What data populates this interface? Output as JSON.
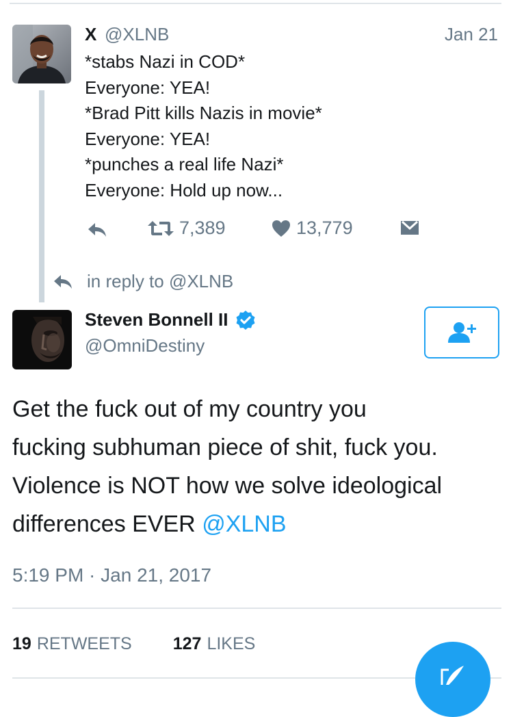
{
  "parent_tweet": {
    "author_name": "X",
    "author_handle": "@XLNB",
    "date": "Jan 21",
    "lines": [
      "*stabs Nazi in COD*",
      "Everyone: YEA!",
      "*Brad Pitt kills Nazis in movie*",
      "Everyone: YEA!",
      "*punches a real life Nazi*",
      "Everyone: Hold up now..."
    ],
    "retweet_count": "7,389",
    "like_count": "13,779"
  },
  "in_reply_to": "in reply to @XLNB",
  "main_tweet": {
    "author_name": "Steven Bonnell II",
    "author_handle": "@OmniDestiny",
    "lines": [
      "Get the fuck out of my country you",
      "fucking subhuman piece of shit, fuck you.",
      "Violence is NOT how we solve ideological",
      "differences EVER "
    ],
    "mention": "@XLNB",
    "timestamp": "5:19 PM · Jan 21, 2017",
    "retweets_count": "19",
    "retweets_label": "RETWEETS",
    "likes_count": "127",
    "likes_label": "LIKES"
  },
  "icons": {
    "reply": "reply-icon",
    "retweet": "retweet-icon",
    "like": "heart-icon",
    "dm": "envelope-icon",
    "verified": "verified-badge-icon",
    "follow": "add-user-icon",
    "compose": "compose-quill-icon"
  },
  "colors": {
    "accent": "#1da1f2",
    "secondary_text": "#657786",
    "primary_text": "#14171a",
    "divider": "#dfe4e8"
  }
}
